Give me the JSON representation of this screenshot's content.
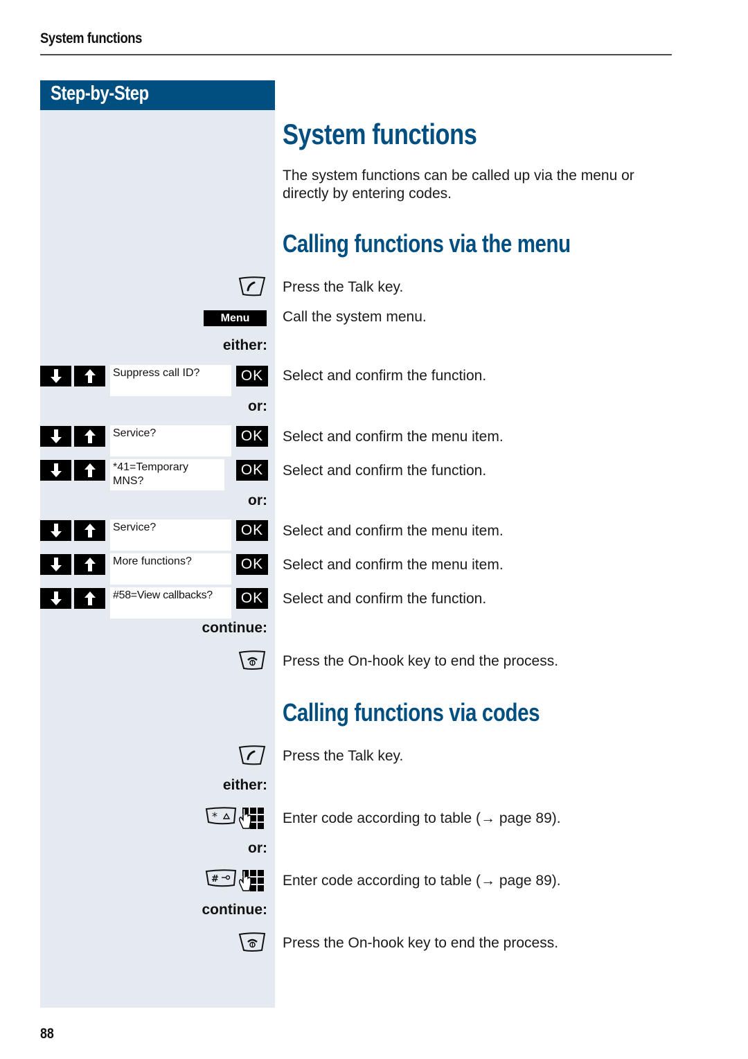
{
  "running_header": "System functions",
  "sidebar": {
    "title": "Step-by-Step"
  },
  "page_title": "System functions",
  "intro": "The system functions can be called up via the menu or directly by entering codes.",
  "sections": [
    {
      "heading": "Calling functions via the menu",
      "steps": [
        {
          "icon": "talk-key-icon",
          "text": "Press the Talk key."
        },
        {
          "key_label": "Menu",
          "text": "Call the system menu."
        },
        {
          "label": "either:"
        },
        {
          "display": "Suppress call ID?",
          "ok": "OK",
          "text": "Select and confirm the function."
        },
        {
          "label": "or:"
        },
        {
          "display": "Service?",
          "ok": "OK",
          "text": "Select and confirm the menu item."
        },
        {
          "display": "*41=Temporary MNS?",
          "ok": "OK",
          "text": "Select and confirm the function."
        },
        {
          "label": "or:"
        },
        {
          "display": "Service?",
          "ok": "OK",
          "text": "Select and confirm the menu item."
        },
        {
          "display": "More functions?",
          "ok": "OK",
          "text": "Select and confirm the menu item."
        },
        {
          "display": "#58=View callbacks?",
          "ok": "OK",
          "text": "Select and confirm the function."
        },
        {
          "label": "continue:"
        },
        {
          "icon": "on-hook-key-icon",
          "text": "Press the On-hook key to end the process."
        }
      ]
    },
    {
      "heading": "Calling functions via codes",
      "steps": [
        {
          "icon": "talk-key-icon",
          "text": "Press the Talk key."
        },
        {
          "label": "either:"
        },
        {
          "icon": "star-key-keypad-icon",
          "text": "Enter code according to table (→ page 89)."
        },
        {
          "label": "or:"
        },
        {
          "icon": "hash-key-keypad-icon",
          "text": "Enter code according to table (→ page 89)."
        },
        {
          "label": "continue:"
        },
        {
          "icon": "on-hook-key-icon",
          "text": "Press the On-hook key to end the process."
        }
      ]
    }
  ],
  "page_number": "88"
}
